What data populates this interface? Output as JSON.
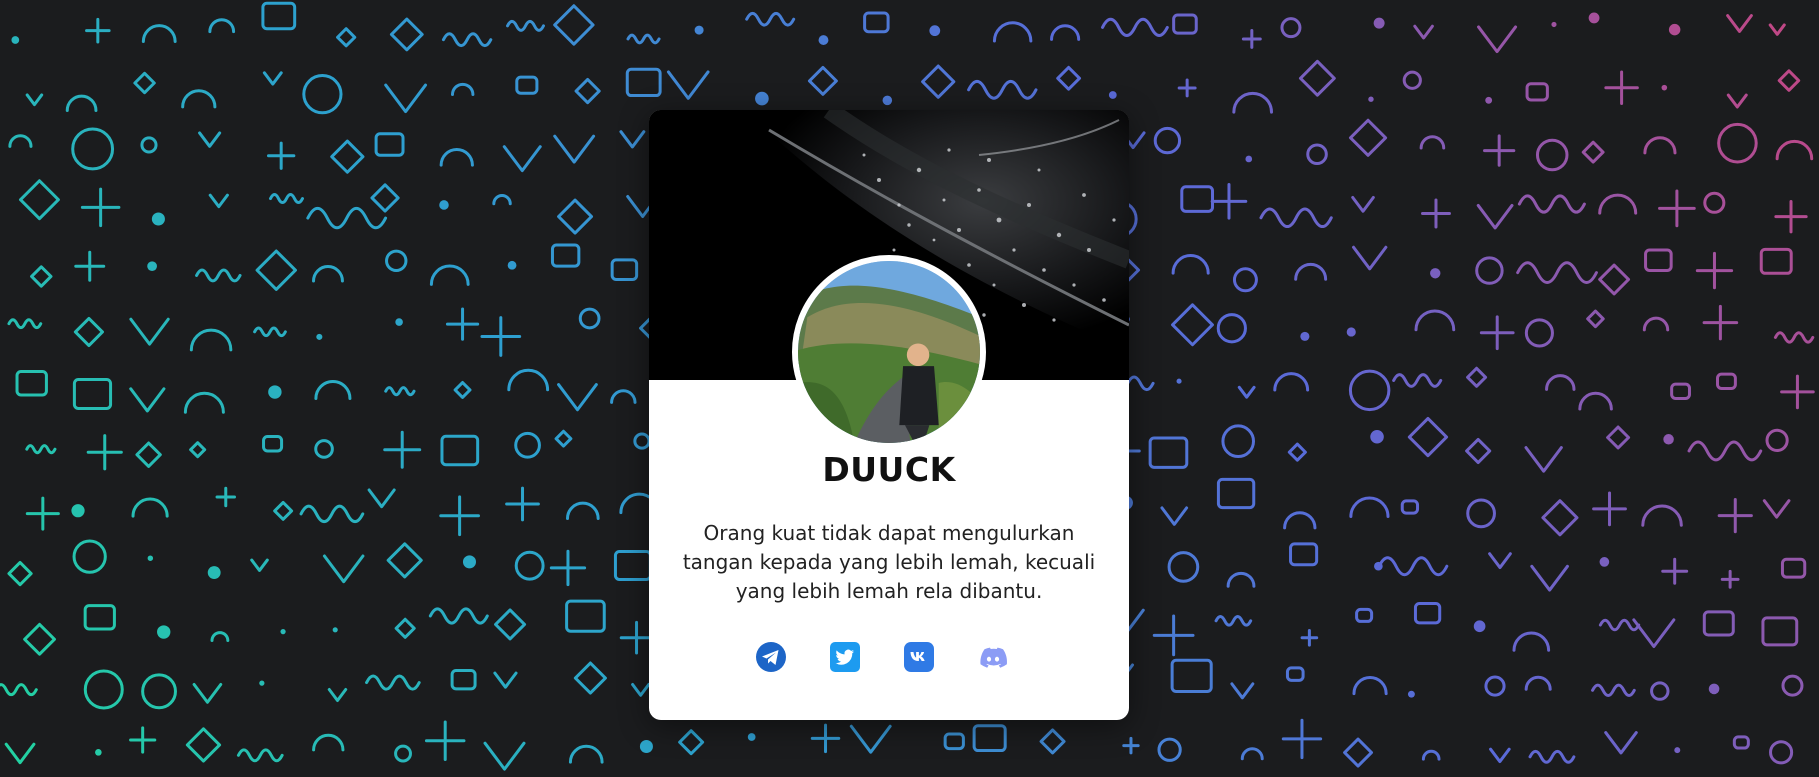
{
  "profile": {
    "name": "DUUCK",
    "bio": "Orang kuat tidak dapat mengulurkan tangan kepada yang lebih lemah, kecuali yang lebih lemah rela dibantu."
  },
  "socials": [
    {
      "icon": "telegram-icon",
      "color": "#1d65c7"
    },
    {
      "icon": "twitter-icon",
      "color": "#1d9bf0"
    },
    {
      "icon": "vk-icon",
      "color": "#2f7ae5"
    },
    {
      "icon": "discord-icon",
      "color": "#8c9cf5"
    }
  ],
  "theme": {
    "background": "#1b1c1e",
    "pattern_gradient": [
      "#23d3a0",
      "#2e9fd0",
      "#5a6ad8",
      "#c8457f"
    ],
    "card": "#ffffff"
  }
}
